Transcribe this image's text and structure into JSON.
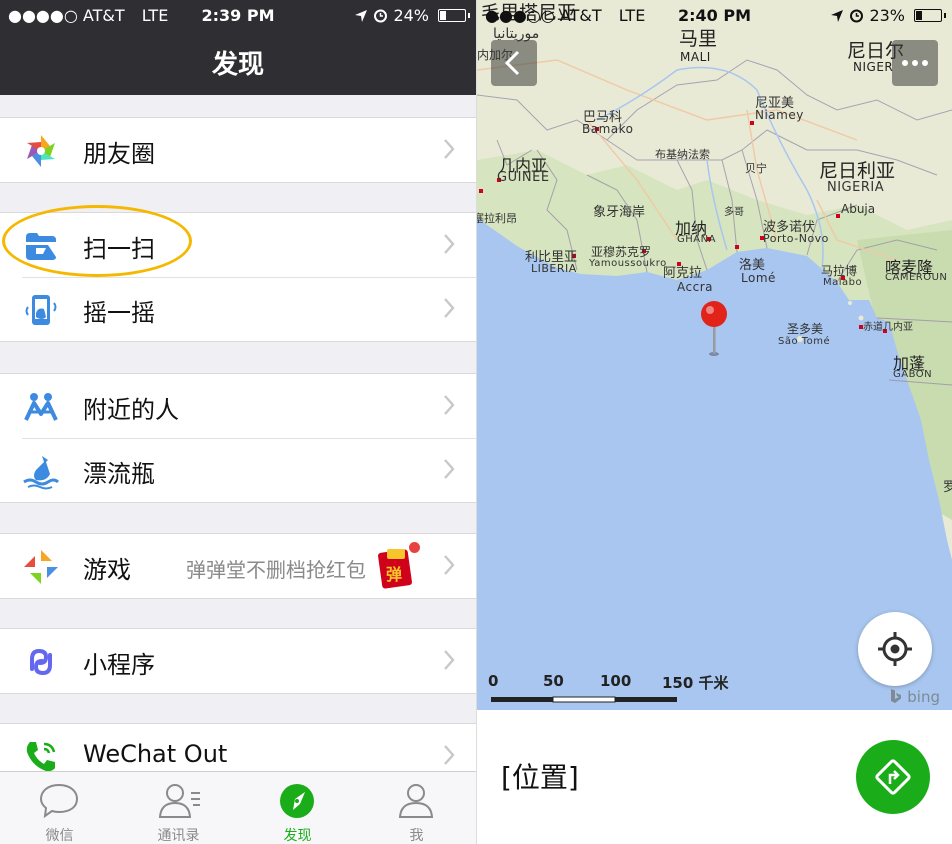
{
  "left_screen": {
    "status_bar": {
      "carrier": "●●●●○ AT&T",
      "network": "LTE",
      "time": "2:39 PM",
      "battery": "24%",
      "battery_level": 0.24
    },
    "title": "发现",
    "items": [
      {
        "label": "朋友圈",
        "icon": "moments-icon"
      },
      {
        "label": "扫一扫",
        "icon": "scan-icon"
      },
      {
        "label": "摇一摇",
        "icon": "shake-icon"
      },
      {
        "label": "附近的人",
        "icon": "people-nearby-icon"
      },
      {
        "label": "漂流瓶",
        "icon": "drift-bottle-icon"
      },
      {
        "label": "游戏",
        "icon": "games-icon",
        "subtitle": "弹弹堂不删档抢红包",
        "badge_text": "弹"
      },
      {
        "label": "小程序",
        "icon": "mini-program-icon"
      },
      {
        "label": "WeChat Out",
        "icon": "wechat-out-icon"
      }
    ],
    "tabs": [
      {
        "label": "微信",
        "icon": "chat-bubble-icon",
        "active": false
      },
      {
        "label": "通讯录",
        "icon": "contacts-icon",
        "active": false
      },
      {
        "label": "发现",
        "icon": "compass-icon",
        "active": true
      },
      {
        "label": "我",
        "icon": "me-icon",
        "active": false
      }
    ],
    "accent_color": "#1aad19",
    "highlight_color": "#f5b800"
  },
  "right_screen": {
    "status_bar": {
      "carrier": "●●●○○ AT&T",
      "network": "LTE",
      "time": "2:40 PM",
      "battery": "23%",
      "battery_level": 0.23
    },
    "map_labels": {
      "mauritania_zh": "毛里塔尼亚",
      "mauritania_ar": "موريتانيا",
      "mali_zh": "马里",
      "mali_en": "MALI",
      "niger_zh": "尼日尔",
      "niger_en": "NIGER",
      "senegal_partial": "内加尔",
      "bamako_zh": "巴马科",
      "bamako_en": "Bamako",
      "niamey_zh": "尼亚美",
      "niamey_en": "Niamey",
      "guinea_zh": "几内亚",
      "guinea_en": "GUINÉE",
      "ouagadougou_zh": "布基纳法索",
      "bouake_zh": "贝宁",
      "nigeria_zh": "尼日利亚",
      "nigeria_en": "NIGERIA",
      "abuja": "Abuja",
      "sierra_leone_zh": "塞拉利昂",
      "ivory_coast_zh": "象牙海岸",
      "ghana_zh": "加纳",
      "ghana_en": "GHANA",
      "togo_zh": "多哥",
      "porto_novo_zh": "波多诺伏",
      "porto_novo_en": "Porto-Novo",
      "liberia_zh": "利比里亚",
      "liberia_en": "LIBERIA",
      "yamoussoukro_zh": "亚穆苏克罗",
      "yamoussoukro_en": "Yamoussoukro",
      "accra_zh": "阿克拉",
      "accra_en": "Accra",
      "lome_zh": "洛美",
      "lome_en": "Lomé",
      "malabo_zh": "马拉博",
      "malabo_en": "Malabo",
      "cameroon_zh": "喀麦隆",
      "cameroon_en": "CAMEROUN",
      "sao_tome_zh": "圣多美",
      "sao_tome_en": "São Tomé",
      "eq_guinea_zh": "赤道几内亚",
      "gabon_zh": "加蓬",
      "gabon_en": "GABON",
      "edge_partial": "罗"
    },
    "scale": {
      "ticks": [
        "0",
        "50",
        "100",
        "150 千米"
      ]
    },
    "attribution": "bing",
    "address": "[位置]",
    "pin_color": "#e2231a",
    "water_color": "#a8c6ef",
    "nav_button_color": "#1aad19"
  }
}
